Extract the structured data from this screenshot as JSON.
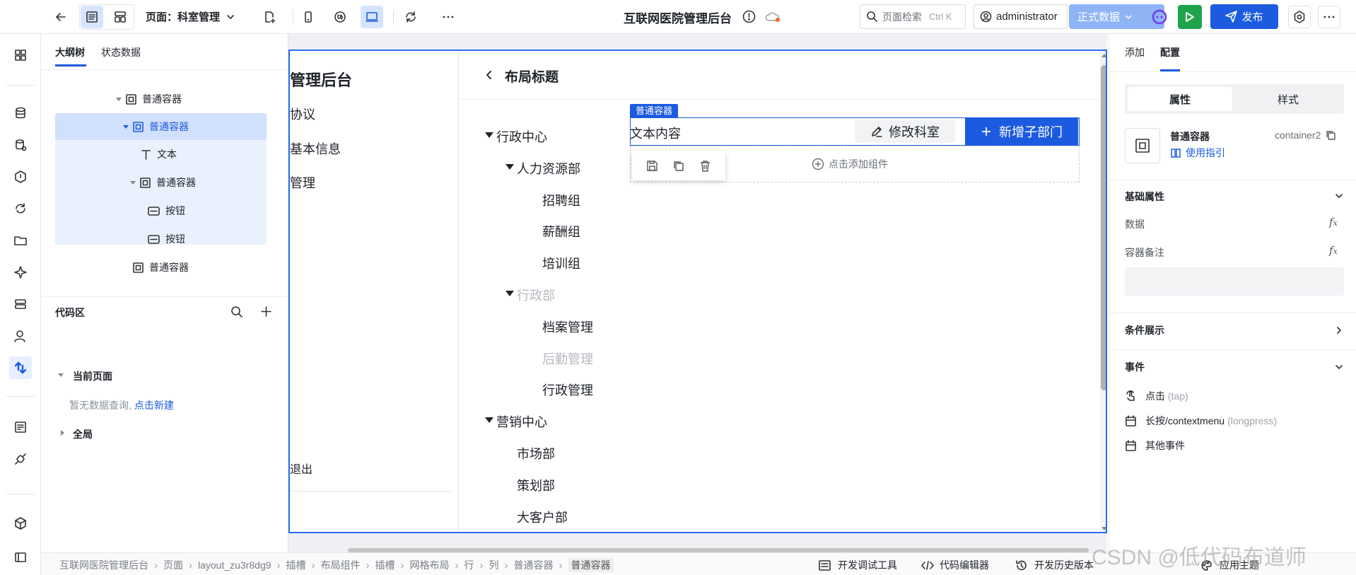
{
  "app": {
    "page_label": "页面：科室管理",
    "title": "互联网医院管理后台",
    "search_placeholder": "页面检索",
    "search_shortcut": "Ctrl K",
    "user": "administrator",
    "env": "正式数据",
    "publish": "发布",
    "accent": "#1c5be0"
  },
  "left": {
    "tabs": [
      "大纲树",
      "状态数据"
    ],
    "tree": [
      "普通容器",
      "普通容器",
      "文本",
      "普通容器",
      "按钮",
      "按钮",
      "普通容器"
    ],
    "code_area": {
      "title": "代码区",
      "current_page": "当前页面",
      "empty_text": "暂无数据查询,",
      "create_link": "点击新建",
      "global": "全局"
    }
  },
  "canvas": {
    "sidebar_title": "管理后台",
    "sidebar_items": [
      "协议",
      "基本信息",
      "管理",
      "退出"
    ],
    "layout_title": "布局标题",
    "container_tag": "普通容器",
    "text_content": "文本内容",
    "edit_btn": "修改科室",
    "add_btn": "新增子部门",
    "add_component": "点击添加组件",
    "tree": [
      {
        "label": "行政中心",
        "level": 0,
        "expanded": true,
        "dim": false
      },
      {
        "label": "人力资源部",
        "level": 1,
        "expanded": true,
        "dim": false
      },
      {
        "label": "招聘组",
        "level": 2,
        "dim": false
      },
      {
        "label": "薪酬组",
        "level": 2,
        "dim": false
      },
      {
        "label": "培训组",
        "level": 2,
        "dim": false
      },
      {
        "label": "行政部",
        "level": 1,
        "expanded": true,
        "dim": true
      },
      {
        "label": "档案管理",
        "level": 2,
        "dim": false
      },
      {
        "label": "后勤管理",
        "level": 2,
        "dim": true
      },
      {
        "label": "行政管理",
        "level": 2,
        "dim": false
      },
      {
        "label": "营销中心",
        "level": 0,
        "expanded": true,
        "dim": false
      },
      {
        "label": "市场部",
        "level": 1,
        "dim": false
      },
      {
        "label": "策划部",
        "level": 1,
        "dim": false
      },
      {
        "label": "大客户部",
        "level": 1,
        "dim": false
      }
    ]
  },
  "right": {
    "tabs": [
      "添加",
      "配置"
    ],
    "seg": [
      "属性",
      "样式"
    ],
    "component_name": "普通容器",
    "component_id": "container2",
    "guide": "使用指引",
    "basic_title": "基础属性",
    "data_label": "数据",
    "note_label": "容器备注",
    "cond_title": "条件展示",
    "events_title": "事件",
    "event_click": "点击",
    "event_click_key": "(tap)",
    "event_long": "长按/contextmenu",
    "event_long_key": "(longpress)",
    "event_other": "其他事件"
  },
  "bottom": {
    "breadcrumb": [
      "互联网医院管理后台",
      "页面",
      "layout_zu3r8dg9",
      "插槽",
      "布局组件",
      "插槽",
      "网格布局",
      "行",
      "列",
      "普通容器",
      "普通容器"
    ],
    "tools": [
      "开发调试工具",
      "代码编辑器",
      "开发历史版本",
      "应用主题"
    ],
    "watermark": "CSDN @低代码布道师"
  }
}
